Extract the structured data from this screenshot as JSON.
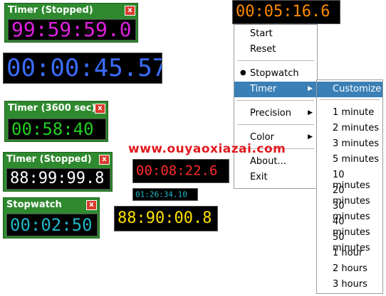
{
  "windows": [
    {
      "title": "Timer (Stopped)",
      "time": "99:59:59.0",
      "color": "#e020e0"
    },
    {
      "title": "Timer (3600 sec)",
      "time": "00:58:40",
      "color": "#22d022"
    },
    {
      "title": "Timer (Stopped)",
      "time": "88:99:99.8",
      "color": "#ffffff"
    },
    {
      "title": "Stopwatch",
      "time": "00:02:50",
      "color": "#1fb8c8"
    }
  ],
  "close_glyph": "x",
  "displays": [
    {
      "time": "00:00:45.57",
      "color": "#3c6cff"
    },
    {
      "time": "00:05:16.6",
      "color": "#ff8a00"
    },
    {
      "time": "00:08:22.6",
      "color": "#ff2b2b"
    },
    {
      "time": "01:26:34.10",
      "color": "#1fb8c8"
    },
    {
      "time": "88:90:00.8",
      "color": "#ffe000"
    }
  ],
  "menu": {
    "items": [
      "Start",
      "Reset",
      "Stopwatch",
      "Timer",
      "Precision",
      "Color",
      "About...",
      "Exit"
    ],
    "bullet": "●",
    "arrow": "▶"
  },
  "submenu": {
    "items": [
      "Customize",
      "1 minute",
      "2 minutes",
      "3 minutes",
      "5 minutes",
      "10 minutes",
      "20 minutes",
      "30 minutes",
      "40 minutes",
      "50 minutes",
      "1 hour",
      "2 hours",
      "3 hours"
    ]
  },
  "watermark": "www.ouyaoxiazai.com",
  "colors": {
    "window_green": "#2f8a2f",
    "menu_highlight": "#3a7fb6",
    "close_red": "#d83a2c",
    "watermark_red": "#e0191e"
  }
}
